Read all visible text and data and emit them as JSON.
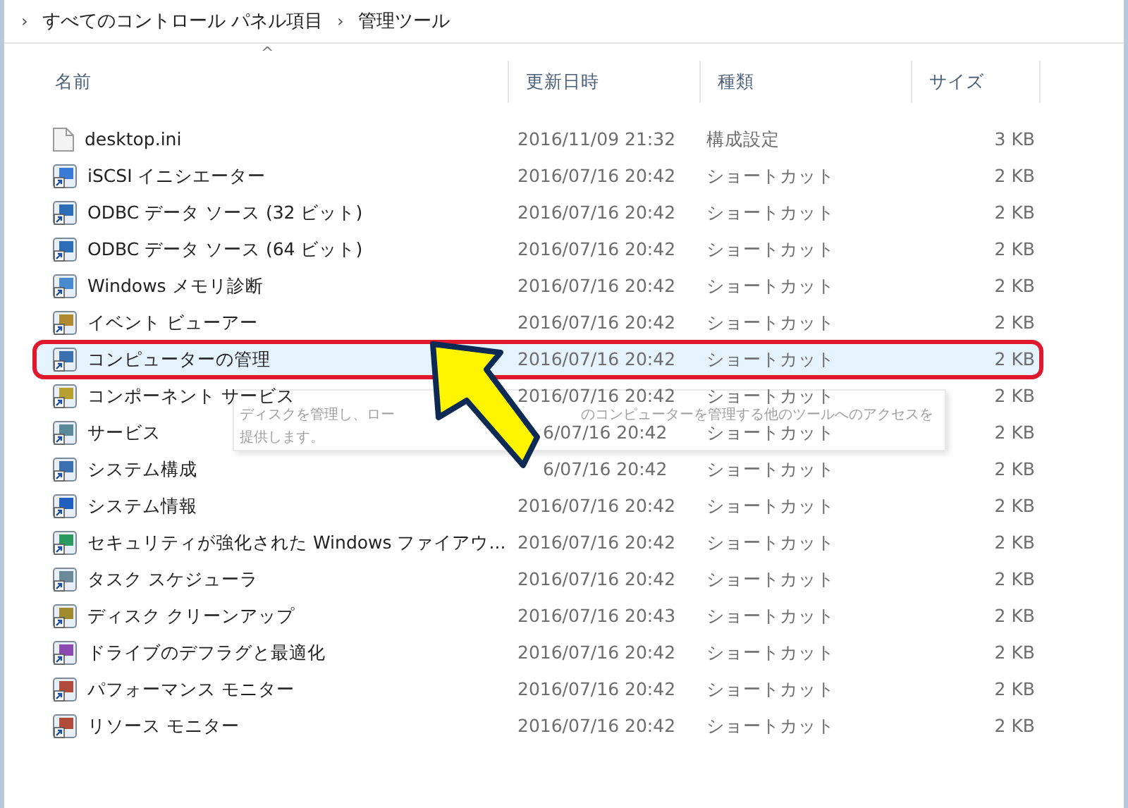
{
  "breadcrumb": [
    {
      "chevron": "›",
      "label": "すべてのコントロール パネル項目"
    },
    {
      "chevron": "›",
      "label": "管理ツール"
    }
  ],
  "table": {
    "sort_indicator": "^",
    "columns": [
      "名前",
      "更新日時",
      "種類",
      "サイズ"
    ],
    "rows": [
      {
        "name": "desktop.ini",
        "modified": "2016/11/09 21:32",
        "type": "構成設定",
        "size": "3 KB",
        "kind": "file",
        "selected": false
      },
      {
        "name": "iSCSI イニシエーター",
        "modified": "2016/07/16 20:42",
        "type": "ショートカット",
        "size": "2 KB",
        "kind": "shortcut",
        "selected": false
      },
      {
        "name": "ODBC データ ソース (32 ビット)",
        "modified": "2016/07/16 20:42",
        "type": "ショートカット",
        "size": "2 KB",
        "kind": "shortcut",
        "selected": false
      },
      {
        "name": "ODBC データ ソース (64 ビット)",
        "modified": "2016/07/16 20:42",
        "type": "ショートカット",
        "size": "2 KB",
        "kind": "shortcut",
        "selected": false
      },
      {
        "name": "Windows メモリ診断",
        "modified": "2016/07/16 20:42",
        "type": "ショートカット",
        "size": "2 KB",
        "kind": "shortcut",
        "selected": false
      },
      {
        "name": "イベント ビューアー",
        "modified": "2016/07/16 20:42",
        "type": "ショートカット",
        "size": "2 KB",
        "kind": "shortcut",
        "selected": false
      },
      {
        "name": "コンピューターの管理",
        "modified": "2016/07/16 20:42",
        "type": "ショートカット",
        "size": "2 KB",
        "kind": "shortcut",
        "selected": true
      },
      {
        "name": "コンポーネント サービス",
        "modified": "2016/07/16 20:42",
        "type": "ショートカット",
        "size": "2 KB",
        "kind": "shortcut",
        "selected": false
      },
      {
        "name": "サービス",
        "modified": "6/07/16 20:42",
        "type": "ショートカット",
        "size": "2 KB",
        "kind": "shortcut",
        "selected": false
      },
      {
        "name": "システム構成",
        "modified": "6/07/16 20:42",
        "type": "ショートカット",
        "size": "2 KB",
        "kind": "shortcut",
        "selected": false
      },
      {
        "name": "システム情報",
        "modified": "2016/07/16 20:42",
        "type": "ショートカット",
        "size": "2 KB",
        "kind": "shortcut",
        "selected": false
      },
      {
        "name": "セキュリティが強化された Windows ファイアウ...",
        "modified": "2016/07/16 20:42",
        "type": "ショートカット",
        "size": "2 KB",
        "kind": "shortcut",
        "selected": false
      },
      {
        "name": "タスク スケジューラ",
        "modified": "2016/07/16 20:42",
        "type": "ショートカット",
        "size": "2 KB",
        "kind": "shortcut",
        "selected": false
      },
      {
        "name": "ディスク クリーンアップ",
        "modified": "2016/07/16 20:43",
        "type": "ショートカット",
        "size": "2 KB",
        "kind": "shortcut",
        "selected": false
      },
      {
        "name": "ドライブのデフラグと最適化",
        "modified": "2016/07/16 20:42",
        "type": "ショートカット",
        "size": "2 KB",
        "kind": "shortcut",
        "selected": false
      },
      {
        "name": "パフォーマンス モニター",
        "modified": "2016/07/16 20:42",
        "type": "ショートカット",
        "size": "2 KB",
        "kind": "shortcut",
        "selected": false
      },
      {
        "name": "リソース モニター",
        "modified": "2016/07/16 20:42",
        "type": "ショートカット",
        "size": "2 KB",
        "kind": "shortcut",
        "selected": false
      }
    ]
  },
  "tooltip": {
    "lines": [
      [
        "ディスクを管理し、ロー",
        "のコンピューターを管理する他のツールへのアクセスを"
      ],
      [
        "提供します。"
      ]
    ]
  }
}
